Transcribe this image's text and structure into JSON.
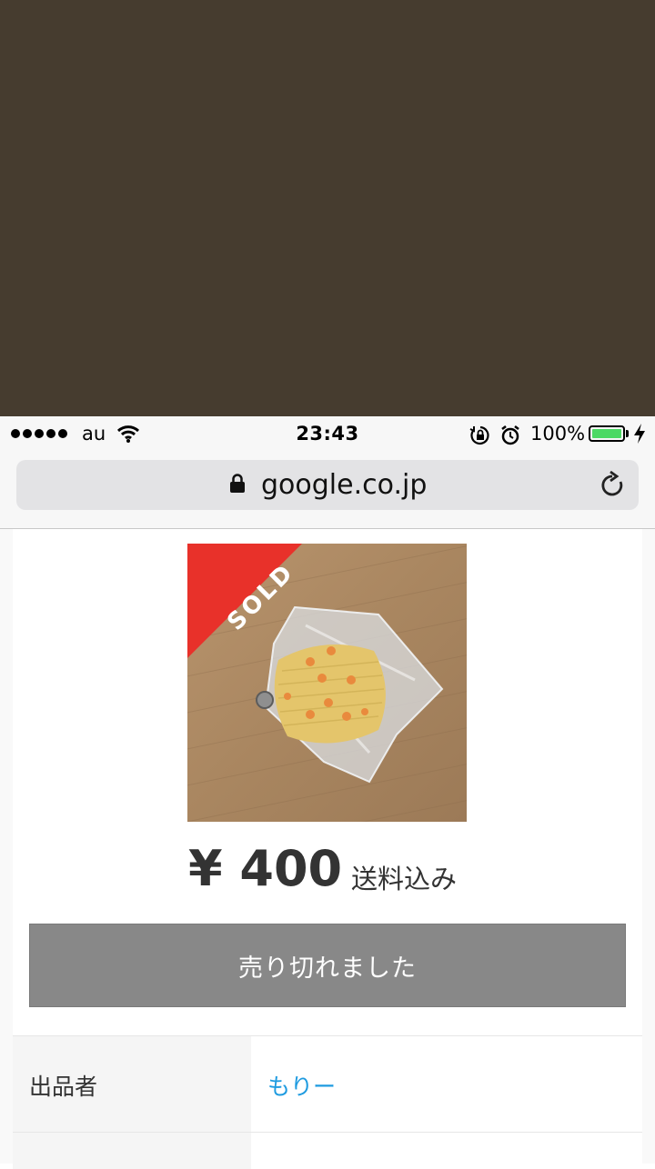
{
  "status_bar": {
    "carrier": "au",
    "time": "23:43",
    "battery_percent": "100%",
    "battery_level": 1.0,
    "battery_color": "#4cd964"
  },
  "browser": {
    "url": "google.co.jp",
    "lock_icon": "lock-icon",
    "reload_icon": "reload-icon"
  },
  "listing": {
    "sold_badge": "SOLD",
    "price": "¥ 400",
    "shipping": "送料込み",
    "sold_out_button": "売り切れました",
    "sold_badge_color": "#e8312a",
    "button_color": "#888888"
  },
  "details": [
    {
      "label": "出品者",
      "value": "もりー",
      "value_color": "#1e9be0"
    },
    {
      "label": "",
      "value": ""
    }
  ],
  "colors": {
    "top_background": "#463c2f"
  }
}
